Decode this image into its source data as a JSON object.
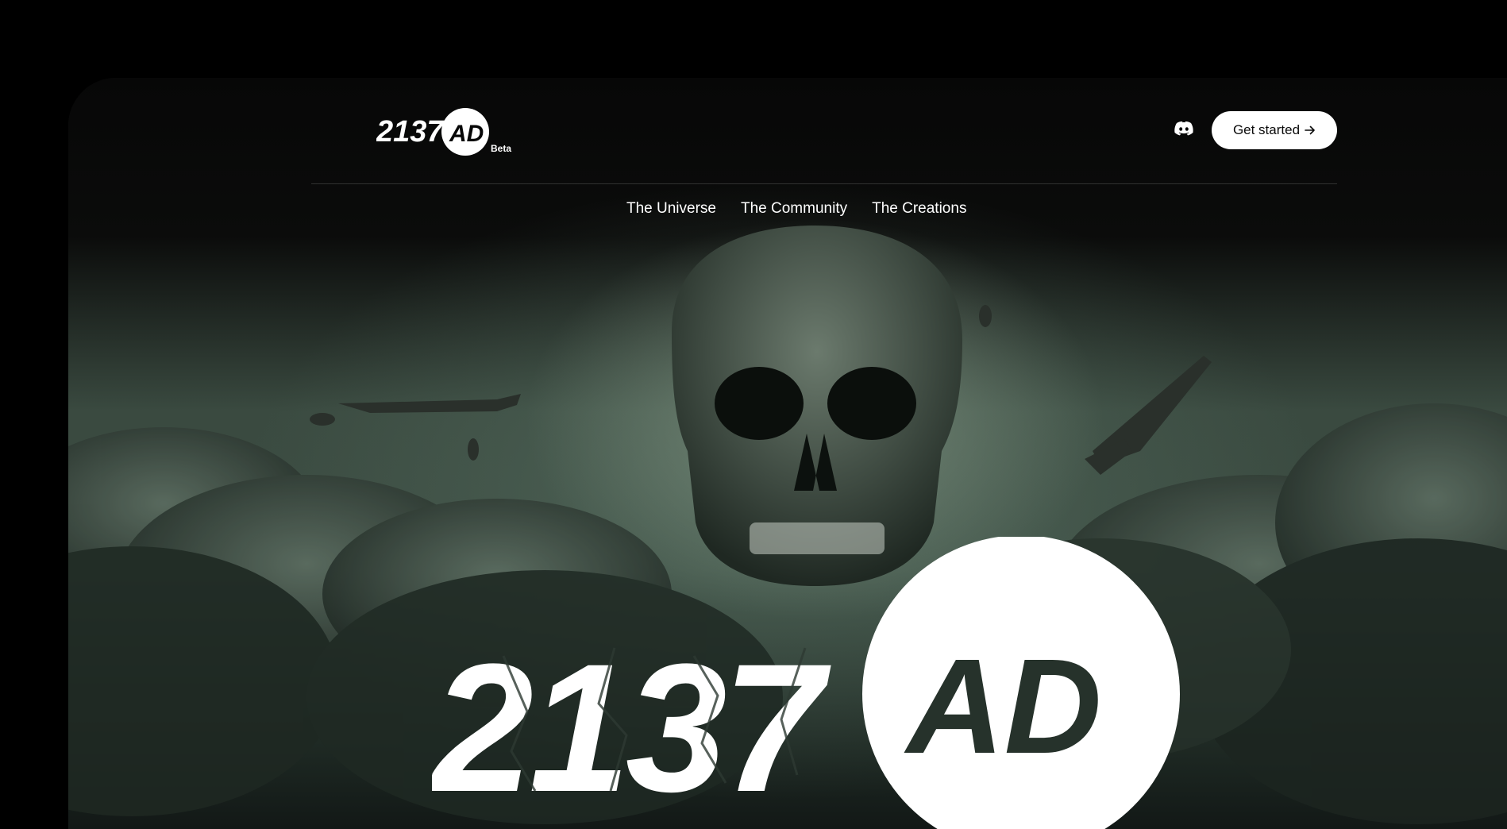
{
  "header": {
    "logo_text": "2137AD",
    "beta_label": "Beta",
    "cta_label": "Get started",
    "cta_icon": "arrow-right-icon",
    "social_icon": "discord-icon"
  },
  "nav": {
    "items": [
      {
        "label": "The Universe"
      },
      {
        "label": "The Community"
      },
      {
        "label": "The Creations"
      }
    ]
  },
  "hero": {
    "logo_text": "2137AD"
  },
  "colors": {
    "background": "#000000",
    "frame": "#070707",
    "button_bg": "#ffffff",
    "button_text": "#0a0a0a",
    "text": "#ffffff"
  }
}
